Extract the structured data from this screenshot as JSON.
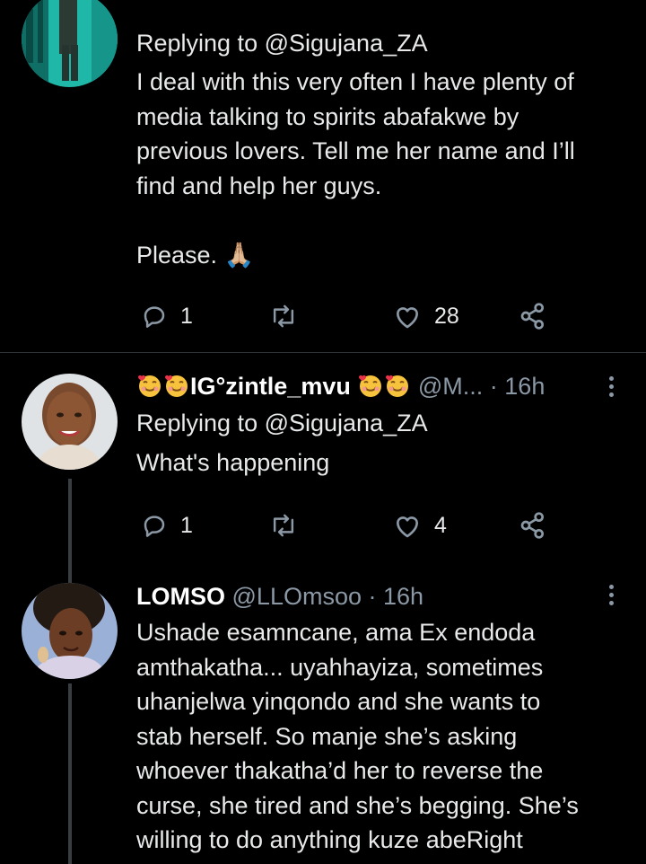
{
  "tweets": [
    {
      "reply_prefix": "Replying to ",
      "reply_handle": "@Sigujana_ZA",
      "text": "I deal with this very often I have plenty of\nmedia talking to spirits abafakwe by\nprevious lovers. Tell me her name and I’ll\nfind and help her guys.\n\nPlease. 🙏🏼",
      "replies": "1",
      "likes": "28"
    },
    {
      "name": "IG°zintle_mvu",
      "handle": "@M...",
      "time": "· 16h",
      "reply_prefix": "Replying to ",
      "reply_handle": "@Sigujana_ZA",
      "text": "What's happening",
      "replies": "1",
      "likes": "4"
    },
    {
      "name": "LOMSO",
      "handle": "@LLOmsoo",
      "time": "· 16h",
      "text": "Ushade esamncane, ama Ex endoda\namthakatha... uyahhayiza, sometimes\nuhanjelwa yinqondo and she wants to\nstab herself. So manje she’s asking\nwhoever thakatha’d her to reverse the\ncurse, she tired and she’s begging. She’s\nwilling to do anything kuze abeRight"
    }
  ],
  "colors": {
    "background": "#000000",
    "text": "#e7e9ea",
    "muted": "#8b98a5",
    "divider": "#2f3336",
    "icon": "#8b98a5"
  },
  "icons": [
    "reply-icon",
    "retweet-icon",
    "like-icon",
    "share-icon",
    "more-icon",
    "smiling-face-with-hearts-emoji",
    "folded-hands-emoji"
  ]
}
